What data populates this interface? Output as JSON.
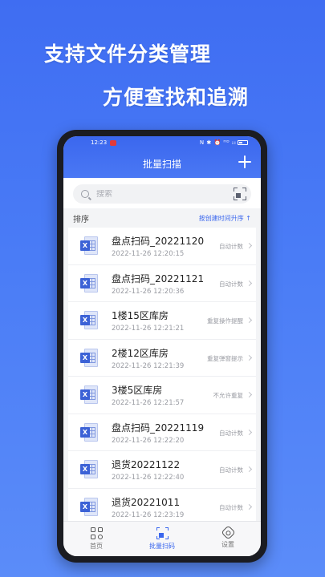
{
  "promo": {
    "line1": "支持文件分类管理",
    "line2": "方便查找和追溯"
  },
  "status_bar": {
    "time": "12:23",
    "right_indicators": "N ✱ ⏰ ᴴᴰ ᵢᵢₗ"
  },
  "app_bar": {
    "title": "批量扫描",
    "add_icon": "plus-icon"
  },
  "search": {
    "placeholder": "搜索",
    "scan_icon": "scan-frame-icon"
  },
  "sort": {
    "label": "排序",
    "order": "按创建时间升序 ↑"
  },
  "files": [
    {
      "name": "盘点扫码_20221120",
      "time": "2022-11-26 12:20:15",
      "tag": "自动计数"
    },
    {
      "name": "盘点扫码_20221121",
      "time": "2022-11-26 12:20:36",
      "tag": "自动计数"
    },
    {
      "name": "1楼15区库房",
      "time": "2022-11-26 12:21:21",
      "tag": "重复操作提醒"
    },
    {
      "name": "2楼12区库房",
      "time": "2022-11-26 12:21:39",
      "tag": "重复弹窗提示"
    },
    {
      "name": "3楼5区库房",
      "time": "2022-11-26 12:21:57",
      "tag": "不允许重复"
    },
    {
      "name": "盘点扫码_20221119",
      "time": "2022-11-26 12:22:20",
      "tag": "自动计数"
    },
    {
      "name": "退货20221122",
      "time": "2022-11-26 12:22:40",
      "tag": "自动计数"
    },
    {
      "name": "退货20221011",
      "time": "2022-11-26 12:23:19",
      "tag": "自动计数"
    }
  ],
  "bottom_nav": [
    {
      "label": "首页",
      "icon": "home-grid-icon"
    },
    {
      "label": "批量扫码",
      "icon": "scan-icon",
      "active": true
    },
    {
      "label": "设置",
      "icon": "settings-icon"
    }
  ],
  "colors": {
    "accent": "#3b67ee",
    "background_gradient_top": "#3f6df2",
    "excel_badge": "#3c62d6"
  }
}
